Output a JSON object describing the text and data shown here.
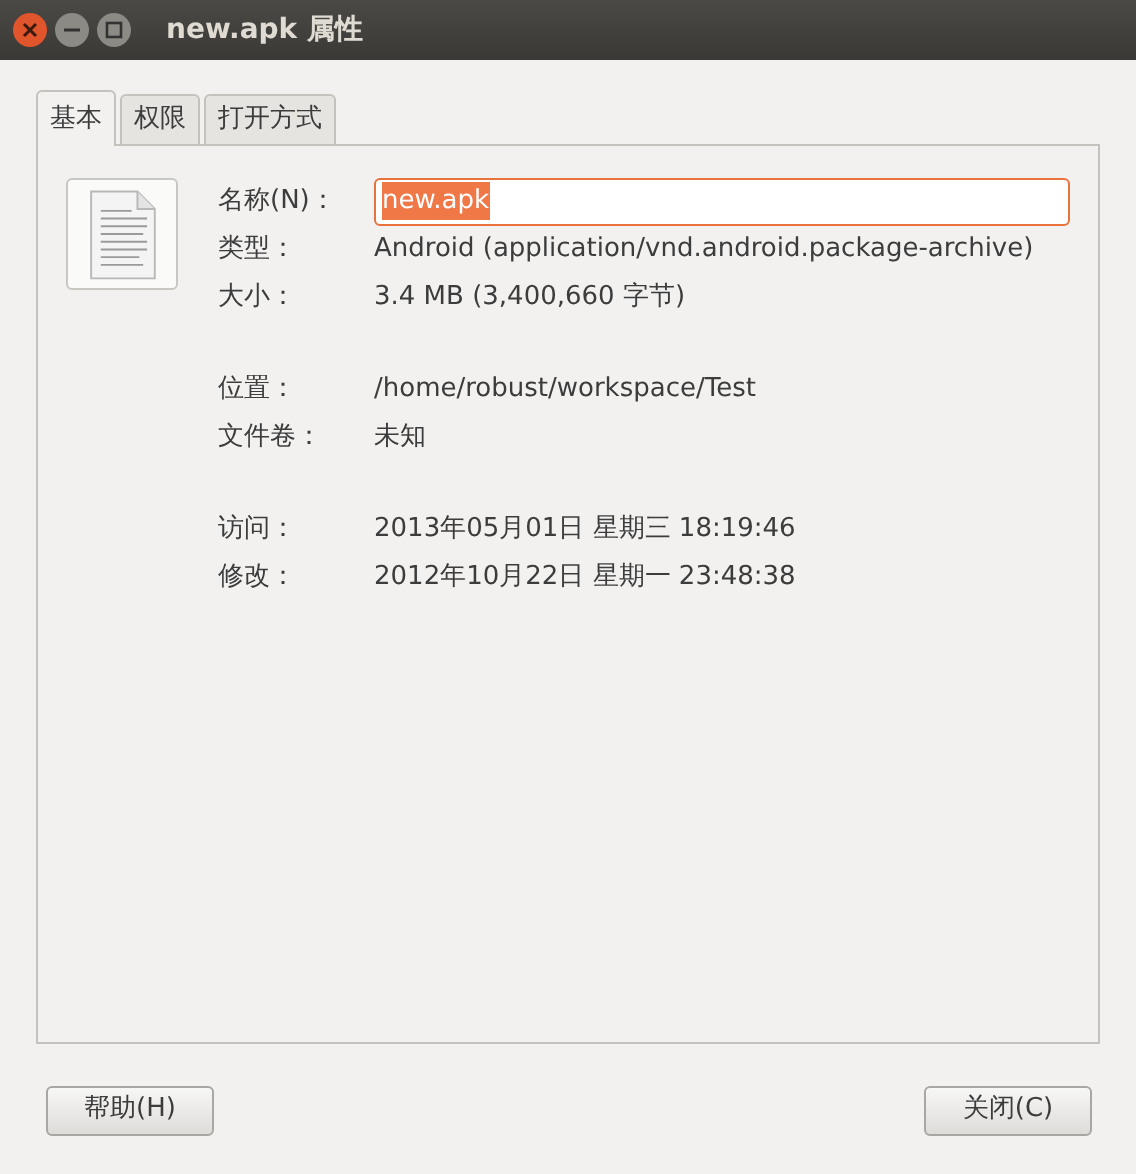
{
  "window": {
    "title": "new.apk 属性"
  },
  "tabs": [
    {
      "label": "基本",
      "selected": true
    },
    {
      "label": "权限",
      "selected": false
    },
    {
      "label": "打开方式",
      "selected": false
    }
  ],
  "groups": [
    [
      {
        "kind": "input",
        "label": "名称(N)：",
        "value": "new.apk",
        "value_selected": true
      },
      {
        "kind": "text",
        "label": "类型：",
        "value": "Android (application/vnd.android.package-archive)"
      },
      {
        "kind": "text",
        "label": "大小：",
        "value": "3.4 MB (3,400,660 字节)"
      }
    ],
    [
      {
        "kind": "text",
        "label": "位置：",
        "value": "/home/robust/workspace/Test"
      },
      {
        "kind": "text",
        "label": "文件卷：",
        "value": "未知"
      }
    ],
    [
      {
        "kind": "text",
        "label": "访问：",
        "value": "2013年05月01日 星期三 18:19:46"
      },
      {
        "kind": "text",
        "label": "修改：",
        "value": "2012年10月22日 星期一 23:48:38"
      }
    ]
  ],
  "buttons": [
    "帮助(H)",
    "关闭(C)"
  ]
}
